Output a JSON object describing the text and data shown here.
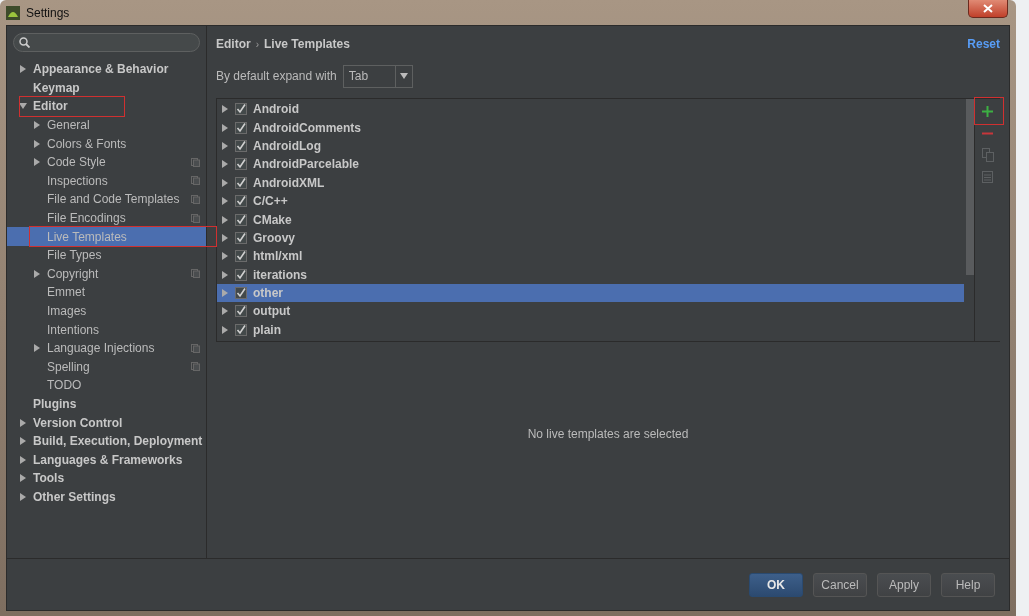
{
  "window": {
    "title": "Settings"
  },
  "sidebar": {
    "items": [
      {
        "label": "Appearance & Behavior",
        "expanded": false,
        "selected": false
      },
      {
        "label": "Keymap",
        "selected": false
      },
      {
        "label": "Editor",
        "expanded": true,
        "selected": false,
        "annotated": true,
        "children": [
          {
            "label": "General",
            "expanded": false,
            "selected": false
          },
          {
            "label": "Colors & Fonts",
            "expanded": false,
            "selected": false
          },
          {
            "label": "Code Style",
            "expanded": false,
            "selected": false,
            "project_icon": true
          },
          {
            "label": "Inspections",
            "selected": false,
            "project_icon": true
          },
          {
            "label": "File and Code Templates",
            "selected": false,
            "project_icon": true
          },
          {
            "label": "File Encodings",
            "selected": false,
            "project_icon": true
          },
          {
            "label": "Live Templates",
            "selected": true,
            "annotated": true
          },
          {
            "label": "File Types",
            "selected": false
          },
          {
            "label": "Copyright",
            "expanded": false,
            "selected": false,
            "project_icon": true
          },
          {
            "label": "Emmet",
            "selected": false
          },
          {
            "label": "Images",
            "selected": false
          },
          {
            "label": "Intentions",
            "selected": false
          },
          {
            "label": "Language Injections",
            "expanded": false,
            "selected": false,
            "project_icon": true
          },
          {
            "label": "Spelling",
            "selected": false,
            "project_icon": true
          },
          {
            "label": "TODO",
            "selected": false
          }
        ]
      },
      {
        "label": "Plugins",
        "selected": false
      },
      {
        "label": "Version Control",
        "expanded": false,
        "selected": false
      },
      {
        "label": "Build, Execution, Deployment",
        "expanded": false,
        "selected": false
      },
      {
        "label": "Languages & Frameworks",
        "expanded": false,
        "selected": false
      },
      {
        "label": "Tools",
        "expanded": false,
        "selected": false
      },
      {
        "label": "Other Settings",
        "expanded": false,
        "selected": false
      }
    ]
  },
  "breadcrumb": {
    "items": [
      "Editor",
      "Live Templates"
    ],
    "separator": "›"
  },
  "reset_link": "Reset",
  "expand_with": {
    "label": "By default expand with",
    "value": "Tab"
  },
  "template_groups": [
    {
      "name": "Android",
      "checked": true,
      "selected": false
    },
    {
      "name": "AndroidComments",
      "checked": true,
      "selected": false
    },
    {
      "name": "AndroidLog",
      "checked": true,
      "selected": false
    },
    {
      "name": "AndroidParcelable",
      "checked": true,
      "selected": false
    },
    {
      "name": "AndroidXML",
      "checked": true,
      "selected": false
    },
    {
      "name": "C/C++",
      "checked": true,
      "selected": false
    },
    {
      "name": "CMake",
      "checked": true,
      "selected": false
    },
    {
      "name": "Groovy",
      "checked": true,
      "selected": false
    },
    {
      "name": "html/xml",
      "checked": true,
      "selected": false
    },
    {
      "name": "iterations",
      "checked": true,
      "selected": false
    },
    {
      "name": "other",
      "checked": true,
      "selected": true
    },
    {
      "name": "output",
      "checked": true,
      "selected": false
    },
    {
      "name": "plain",
      "checked": true,
      "selected": false
    }
  ],
  "toolbar": [
    {
      "kind": "add",
      "annotated": true,
      "disabled": false
    },
    {
      "kind": "remove",
      "disabled": false
    },
    {
      "kind": "copy",
      "disabled": true
    },
    {
      "kind": "edit",
      "disabled": true
    }
  ],
  "empty_message": "No live templates are selected",
  "buttons": [
    {
      "label": "OK",
      "default": true
    },
    {
      "label": "Cancel",
      "default": false
    },
    {
      "label": "Apply",
      "default": false
    },
    {
      "label": "Help",
      "default": false
    }
  ]
}
